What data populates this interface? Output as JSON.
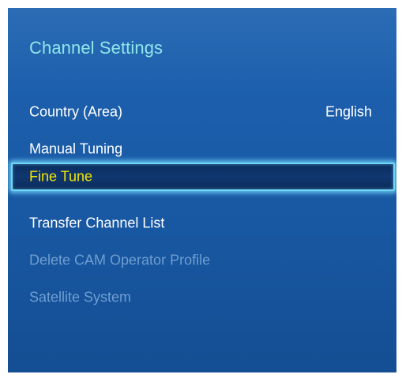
{
  "menu": {
    "title": "Channel Settings",
    "items": [
      {
        "label": "Country (Area)",
        "value": "English"
      },
      {
        "label": "Manual Tuning"
      },
      {
        "label": "Fine Tune"
      },
      {
        "label": "Transfer Channel List"
      },
      {
        "label": "Delete CAM Operator Profile"
      },
      {
        "label": "Satellite System"
      }
    ],
    "selected": "Fine Tune"
  },
  "colors": {
    "background": "#1a5ba7",
    "title": "#8fe6ea",
    "selected_text": "#f3e600",
    "disabled_text": "#6f9ed2",
    "highlight_border": "#6fd7f5"
  }
}
